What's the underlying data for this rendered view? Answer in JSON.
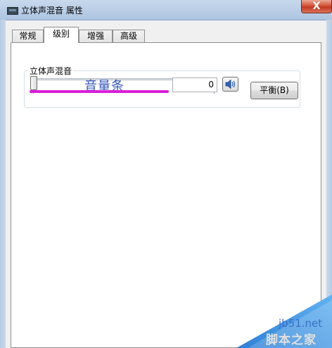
{
  "window": {
    "title": "立体声混音 属性",
    "close_label": "X"
  },
  "tabs": [
    {
      "label": "常规",
      "active": false
    },
    {
      "label": "级别",
      "active": true
    },
    {
      "label": "增强",
      "active": false
    },
    {
      "label": "高级",
      "active": false
    }
  ],
  "levels": {
    "group_label": "立体声混音",
    "volume_value": "0",
    "volume_level": 0,
    "annotation": "音量条",
    "balance_button": "平衡(B)",
    "speaker_icon": "speaker-icon"
  },
  "watermark": {
    "site": "jb51.net",
    "name": "脚本之家"
  },
  "colors": {
    "annotation_line": "#d81fd8",
    "annotation_text": "#3655b8",
    "close_button": "#c23a22"
  }
}
